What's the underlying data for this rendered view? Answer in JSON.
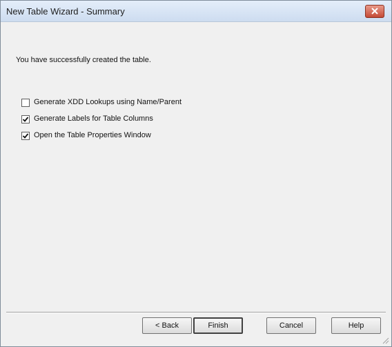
{
  "window": {
    "title": "New Table Wizard - Summary"
  },
  "message": "You have successfully created the table.",
  "options": [
    {
      "label": "Generate XDD Lookups using Name/Parent",
      "checked": false
    },
    {
      "label": "Generate Labels for Table Columns",
      "checked": true
    },
    {
      "label": "Open the Table Properties Window",
      "checked": true
    }
  ],
  "buttons": {
    "back": "< Back",
    "finish": "Finish",
    "cancel": "Cancel",
    "help": "Help"
  },
  "colors": {
    "close_button": "#c44a36",
    "title_bar": "#cddcf0",
    "dialog_background": "#f0f0f0"
  }
}
